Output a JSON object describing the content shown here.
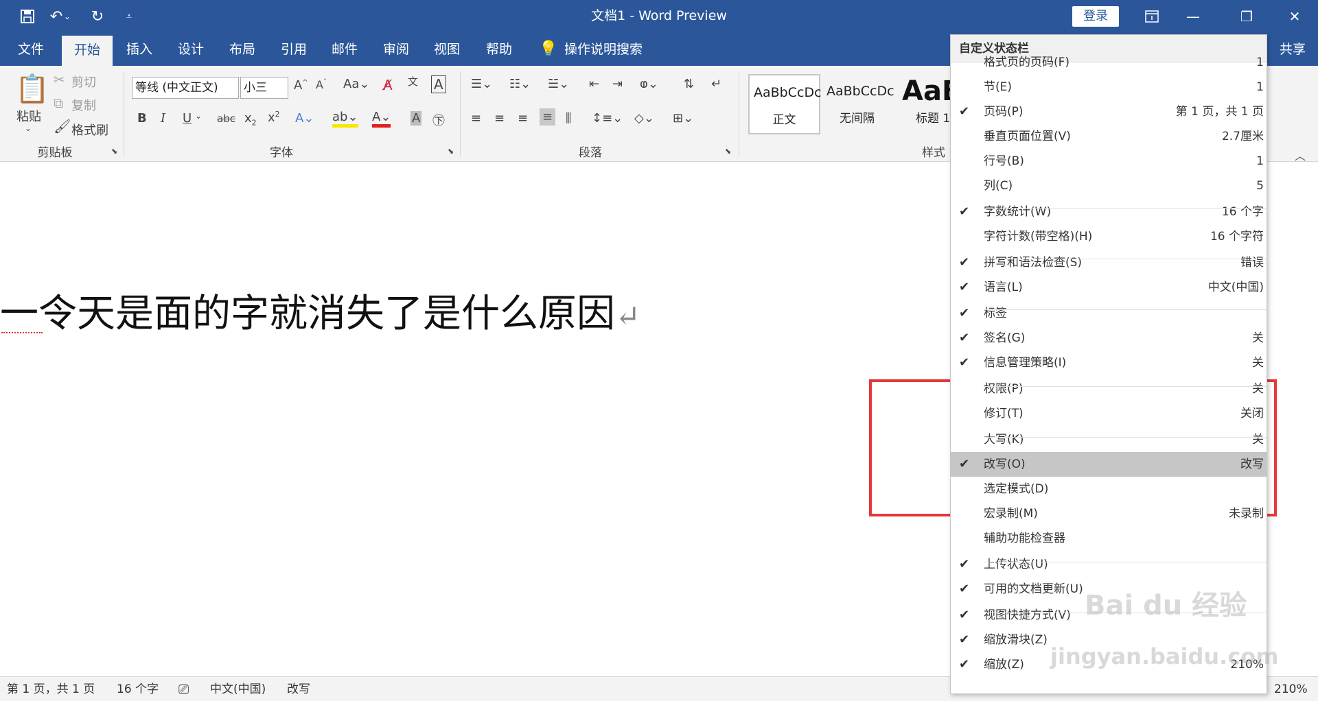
{
  "window": {
    "title": "文档1  -  Word Preview",
    "login": "登录",
    "qat": {
      "save": "save-icon",
      "undo": "undo-icon",
      "redo": "redo-icon",
      "customize": "dropdown-icon"
    }
  },
  "tabs": [
    "文件",
    "开始",
    "插入",
    "设计",
    "布局",
    "引用",
    "邮件",
    "审阅",
    "视图",
    "帮助"
  ],
  "active_tab": "开始",
  "tell_me": "操作说明搜索",
  "share": "共享",
  "ribbon": {
    "clipboard": {
      "paste": "粘贴",
      "cut": "剪切",
      "copy": "复制",
      "format_painter": "格式刷",
      "label": "剪贴板"
    },
    "font": {
      "font_name": "等线 (中文正文)",
      "font_size": "小三",
      "label": "字体"
    },
    "paragraph": {
      "label": "段落"
    },
    "styles": {
      "items": [
        {
          "preview": "AaBbCcDc",
          "name": "正文"
        },
        {
          "preview": "AaBbCcDc",
          "name": "无间隔"
        },
        {
          "preview": "AaB",
          "name": "标题 1"
        }
      ],
      "label": "样式"
    }
  },
  "document": {
    "text": "一令天是面的字就消失了是什么原因"
  },
  "statusbar": {
    "page": "第 1 页，共 1 页",
    "words": "16 个字",
    "language": "中文(中国)",
    "overtype": "改写",
    "zoom": "210%"
  },
  "context_menu": {
    "title": "自定义状态栏",
    "items": [
      {
        "label": "格式页的页码(F)",
        "value": "1",
        "checked": false
      },
      {
        "label": "节(E)",
        "value": "1",
        "checked": false
      },
      {
        "label": "页码(P)",
        "value": "第 1 页，共 1 页",
        "checked": true
      },
      {
        "label": "垂直页面位置(V)",
        "value": "2.7厘米",
        "checked": false
      },
      {
        "label": "行号(B)",
        "value": "1",
        "checked": false
      },
      {
        "label": "列(C)",
        "value": "5",
        "checked": false
      },
      {
        "label": "字数统计(W)",
        "value": "16 个字",
        "checked": true
      },
      {
        "label": "字符计数(带空格)(H)",
        "value": "16 个字符",
        "checked": false
      },
      {
        "label": "拼写和语法检查(S)",
        "value": "错误",
        "checked": true
      },
      {
        "label": "语言(L)",
        "value": "中文(中国)",
        "checked": true
      },
      {
        "label": "标签",
        "value": "",
        "checked": true
      },
      {
        "label": "签名(G)",
        "value": "关",
        "checked": true
      },
      {
        "label": "信息管理策略(I)",
        "value": "关",
        "checked": true
      },
      {
        "label": "权限(P)",
        "value": "关",
        "checked": false
      },
      {
        "label": "修订(T)",
        "value": "关闭",
        "checked": false
      },
      {
        "label": "大写(K)",
        "value": "关",
        "checked": false
      },
      {
        "label": "改写(O)",
        "value": "改写",
        "checked": true,
        "highlighted": true
      },
      {
        "label": "选定模式(D)",
        "value": "",
        "checked": false
      },
      {
        "label": "宏录制(M)",
        "value": "未录制",
        "checked": false
      },
      {
        "label": "辅助功能检查器",
        "value": "",
        "checked": false
      },
      {
        "label": "上传状态(U)",
        "value": "",
        "checked": true
      },
      {
        "label": "可用的文档更新(U)",
        "value": "",
        "checked": true
      },
      {
        "label": "视图快捷方式(V)",
        "value": "",
        "checked": true
      },
      {
        "label": "缩放滑块(Z)",
        "value": "",
        "checked": true
      },
      {
        "label": "缩放(Z)",
        "value": "210%",
        "checked": true
      }
    ]
  },
  "watermark": {
    "line1": "Bai du 经验",
    "line2": "jingyan.baidu.com"
  },
  "colors": {
    "brand": "#2b579a",
    "ribbon_bg": "#f3f3f3",
    "annotation": "#e23a3a",
    "highlight": "#c6c6c6"
  }
}
